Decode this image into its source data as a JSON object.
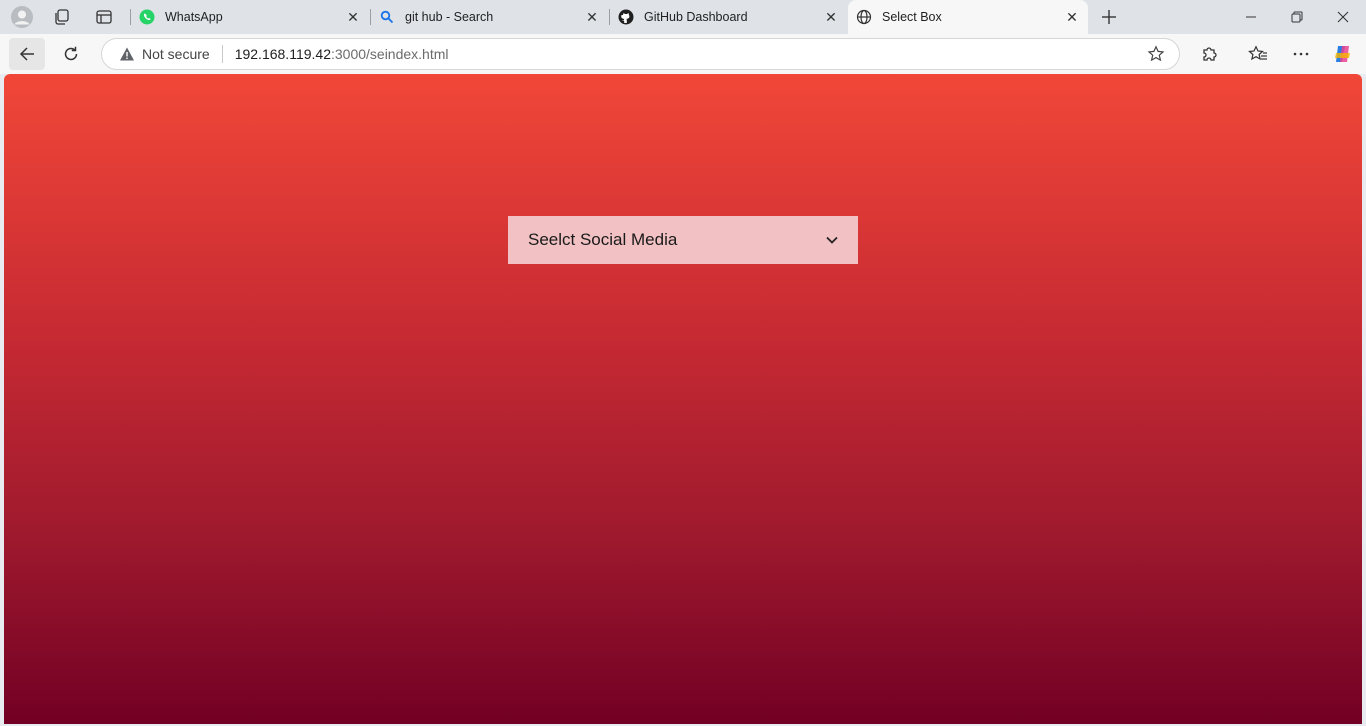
{
  "browser": {
    "tabs": [
      {
        "title": "WhatsApp",
        "favicon": "whatsapp-icon",
        "active": false
      },
      {
        "title": "git hub - Search",
        "favicon": "search-icon",
        "active": false
      },
      {
        "title": "GitHub Dashboard",
        "favicon": "github-icon",
        "active": false
      },
      {
        "title": "Select Box",
        "favicon": "globe-icon",
        "active": true
      }
    ],
    "address": {
      "security_label": "Not secure",
      "url_host": "192.168.119.42",
      "url_rest": ":3000/seindex.html"
    }
  },
  "page": {
    "select": {
      "selected_value": "Seelct Social Media"
    },
    "colors": {
      "gradient_top": "#f14738",
      "gradient_bottom": "#720024",
      "select_background": "#f1c1c3"
    }
  }
}
